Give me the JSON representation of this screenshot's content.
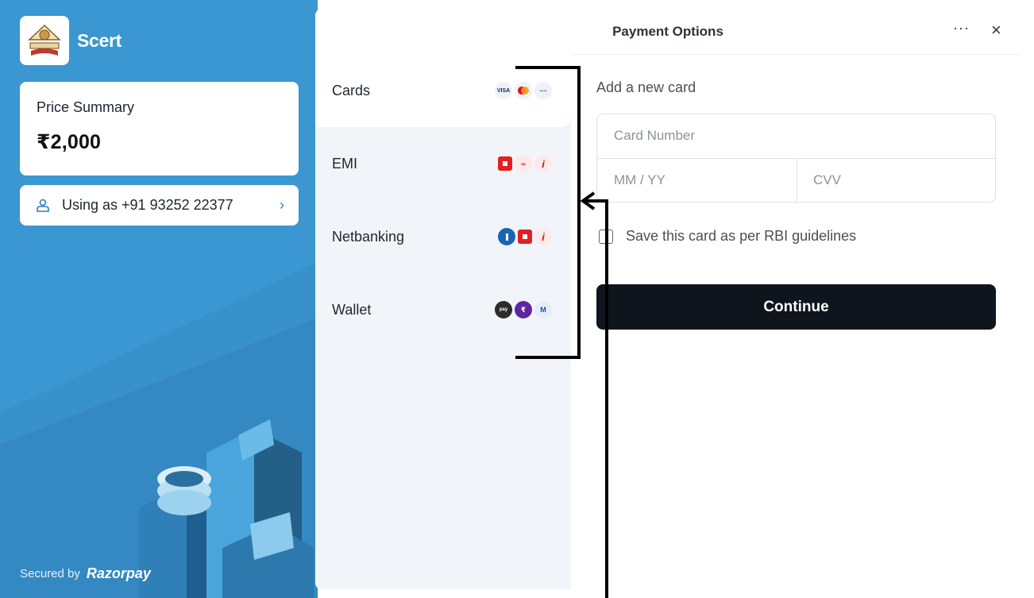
{
  "brand": {
    "name": "Scert",
    "logo": "scert-emblem"
  },
  "price_summary": {
    "label": "Price Summary",
    "amount": "₹2,000"
  },
  "user": {
    "label": "Using as +91 93252 22377",
    "icon": "user-icon",
    "chevron": "›"
  },
  "footer": {
    "secured_by": "Secured by",
    "provider": "Razorpay"
  },
  "modal": {
    "title": "Payment Options",
    "more_label": "···",
    "close_label": "×"
  },
  "methods": [
    {
      "label": "Cards",
      "icons": [
        "visa-icon",
        "mastercard-icon",
        "rupay-icon"
      ]
    },
    {
      "label": "EMI",
      "icons": [
        "hdfc-icon",
        "kotak-icon",
        "icici-icon"
      ]
    },
    {
      "label": "Netbanking",
      "icons": [
        "sbi-icon",
        "hdfc-icon",
        "icici-icon"
      ]
    },
    {
      "label": "Wallet",
      "icons": [
        "amazon-pay-icon",
        "phonepe-icon",
        "mobikwik-icon"
      ]
    }
  ],
  "card_form": {
    "title": "Add a new card",
    "number_placeholder": "Card Number",
    "expiry_placeholder": "MM / YY",
    "cvv_placeholder": "CVV",
    "save_label": "Save this card as per RBI guidelines",
    "continue_label": "Continue"
  },
  "colors": {
    "left_bg": "#3a97d1",
    "methods_bg": "#f1f5f9",
    "continue_bg": "#0e151d"
  }
}
